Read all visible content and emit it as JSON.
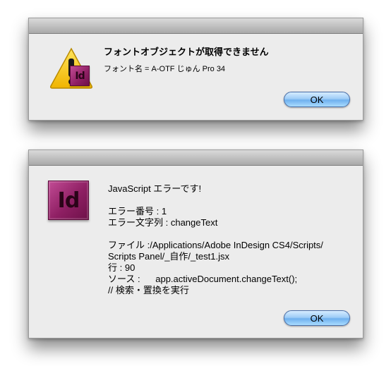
{
  "dialog1": {
    "title": "フォントオブジェクトが取得できません",
    "message": "フォント名 = A-OTF じゅん Pro 34",
    "ok_label": "OK",
    "icon_letters": "Id"
  },
  "dialog2": {
    "icon_letters": "Id",
    "lines": [
      "JavaScript エラーです!",
      "",
      "エラー番号 : 1",
      "エラー文字列 : changeText",
      "",
      "ファイル :/Applications/Adobe InDesign CS4/Scripts/",
      "Scripts Panel/_自作/_test1.jsx",
      "行 : 90",
      "ソース :      app.activeDocument.changeText();",
      "// 検索・置換を実行"
    ],
    "ok_label": "OK"
  },
  "colors": {
    "dialog_bg": "#ececec",
    "indesign_magenta": "#8e1f63",
    "ok_button_blue": "#6fb0ee",
    "warning_yellow": "#f6c400"
  }
}
